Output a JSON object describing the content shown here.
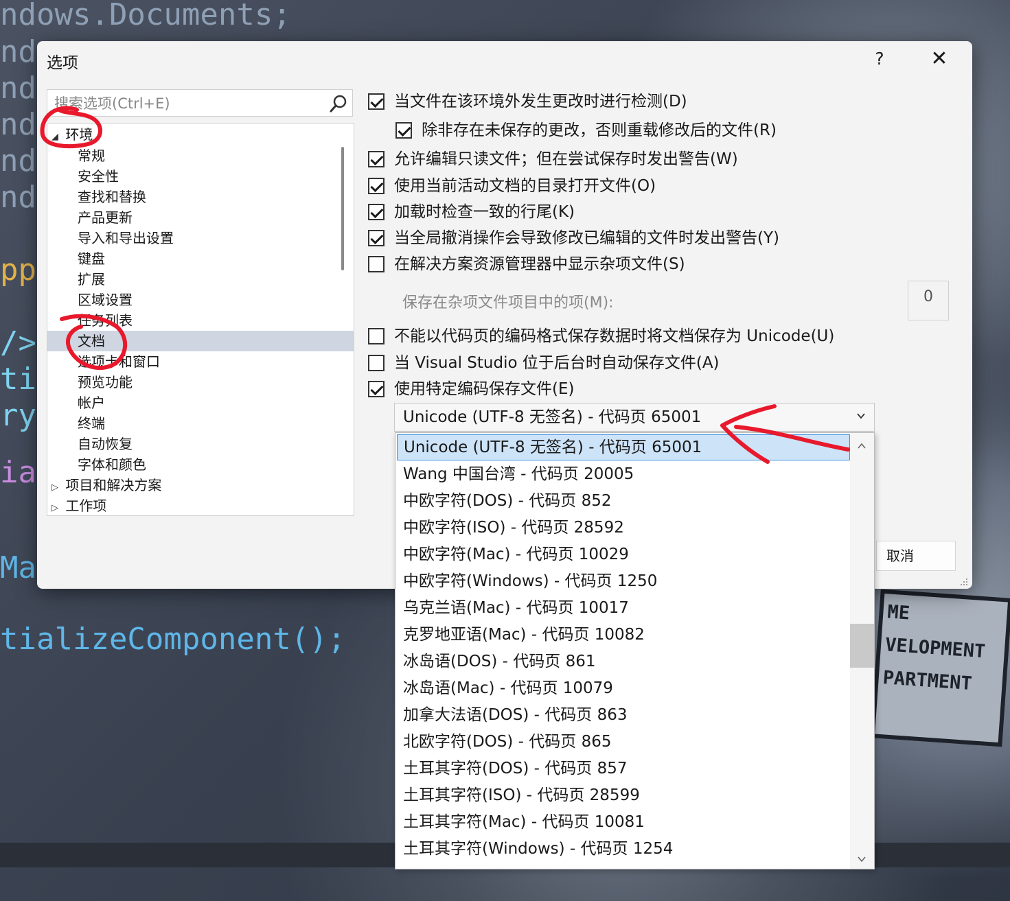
{
  "background": {
    "code_lines": [
      "ndows.Documents;",
      "ndo",
      "ndo",
      "ndo",
      "ndo",
      "ndo",
      "pp",
      "/>",
      "tio",
      "ry>",
      "ial",
      "Mai",
      "tializeComponent();"
    ],
    "poster_lines": [
      "ME",
      "VELOPMENT",
      "PARTMENT"
    ]
  },
  "dialog": {
    "title": "选项",
    "help_label": "?",
    "close_label": "✕"
  },
  "search": {
    "placeholder": "搜索选项(Ctrl+E)"
  },
  "tree": {
    "root_expanded": {
      "label": "环境",
      "expander": "◢"
    },
    "children": [
      "常规",
      "安全性",
      "查找和替换",
      "产品更新",
      "导入和导出设置",
      "键盘",
      "扩展",
      "区域设置",
      "任务列表",
      "文档",
      "选项卡和窗口",
      "预览功能",
      "帐户",
      "终端",
      "自动恢复",
      "字体和颜色"
    ],
    "selected": "文档",
    "collapsed": [
      {
        "label": "项目和解决方案",
        "expander": "▷"
      },
      {
        "label": "工作项",
        "expander": "▷"
      }
    ]
  },
  "options": [
    {
      "label": "当文件在该环境外发生更改时进行检测(D)",
      "checked": true
    },
    {
      "label": "除非存在未保存的更改，否则重载修改后的文件(R)",
      "checked": true
    },
    {
      "label": "允许编辑只读文件；但在尝试保存时发出警告(W)",
      "checked": true
    },
    {
      "label": "使用当前活动文档的目录打开文件(O)",
      "checked": true
    },
    {
      "label": "加载时检查一致的行尾(K)",
      "checked": true
    },
    {
      "label": "当全局撤消操作会导致修改已编辑的文件时发出警告(Y)",
      "checked": true
    },
    {
      "label": "在解决方案资源管理器中显示杂项文件(S)",
      "checked": false
    },
    {
      "label": "不能以代码页的编码格式保存数据时将文档保存为 Unicode(U)",
      "checked": false
    },
    {
      "label": "当 Visual Studio 位于后台时自动保存文件(A)",
      "checked": false
    },
    {
      "label": "使用特定编码保存文件(E)",
      "checked": true
    }
  ],
  "misc_items": {
    "label": "保存在杂项文件项目中的项(M):",
    "value": "0"
  },
  "encoding": {
    "selected": "Unicode (UTF-8 无签名) - 代码页 65001",
    "options": [
      "Unicode (UTF-8 无签名) - 代码页 65001",
      "Wang 中国台湾 - 代码页 20005",
      "中欧字符(DOS) - 代码页 852",
      "中欧字符(ISO) - 代码页 28592",
      "中欧字符(Mac) - 代码页 10029",
      "中欧字符(Windows) - 代码页 1250",
      "乌克兰语(Mac) - 代码页 10017",
      "克罗地亚语(Mac) - 代码页 10082",
      "冰岛语(DOS) - 代码页 861",
      "冰岛语(Mac) - 代码页 10079",
      "加拿大法语(DOS) - 代码页 863",
      "北欧字符(DOS) - 代码页 865",
      "土耳其字符(DOS) - 代码页 857",
      "土耳其字符(ISO) - 代码页 28599",
      "土耳其字符(Mac) - 代码页 10081",
      "土耳其字符(Windows) - 代码页 1254"
    ]
  },
  "buttons": {
    "cancel": "取消"
  },
  "colors": {
    "annotation": "#e8192c",
    "selection_fill": "#cde3f8",
    "selection_border": "#3a8ee6",
    "tree_selection": "#cfd6e2"
  }
}
